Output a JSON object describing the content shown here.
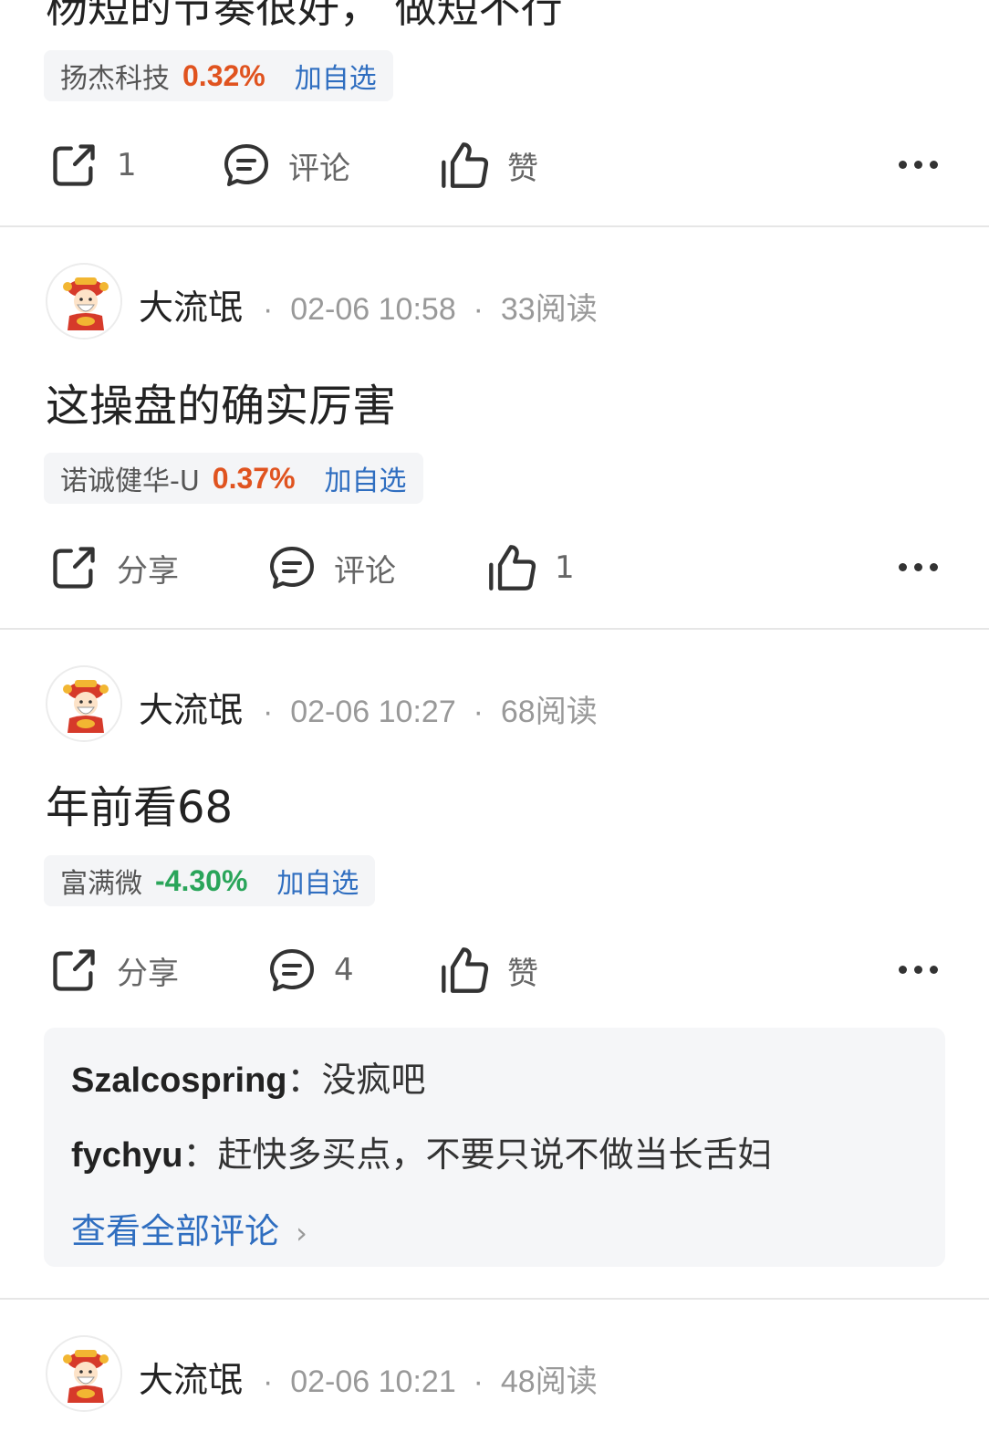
{
  "top_post": {
    "partial_text": "杨短的节奏很好，  做短不行",
    "stock": {
      "name": "扬杰科技",
      "change": "0.32%",
      "add_label": "加自选"
    },
    "actions": {
      "share": "1",
      "comment": "评论",
      "like": "赞"
    }
  },
  "posts": [
    {
      "author": "大流氓",
      "time": "02-06 10:58",
      "reads": "33阅读",
      "text": "这操盘的确实厉害",
      "stock": {
        "name": "诺诚健华-U",
        "change": "0.37%",
        "add_label": "加自选"
      },
      "actions": {
        "share": "分享",
        "comment": "评论",
        "like": "1"
      }
    },
    {
      "author": "大流氓",
      "time": "02-06 10:27",
      "reads": "68阅读",
      "text": "年前看68",
      "stock": {
        "name": "富满微",
        "change": "-4.30%",
        "add_label": "加自选"
      },
      "actions": {
        "share": "分享",
        "comment": "4",
        "like": "赞"
      },
      "comments": [
        {
          "user": "Szalcospring",
          "sep": "：",
          "text": "没疯吧"
        },
        {
          "user": "fychyu",
          "sep": "：",
          "text": "赶快多买点，不要只说不做当长舌妇"
        }
      ],
      "view_all": "查看全部评论",
      "view_all_arrow": "›"
    },
    {
      "author": "大流氓",
      "time": "02-06 10:21",
      "reads": "48阅读"
    }
  ],
  "meta_dot": "·",
  "colors": {
    "up": "#e0531f",
    "down": "#2aa55a",
    "link": "#2f6ec0"
  }
}
